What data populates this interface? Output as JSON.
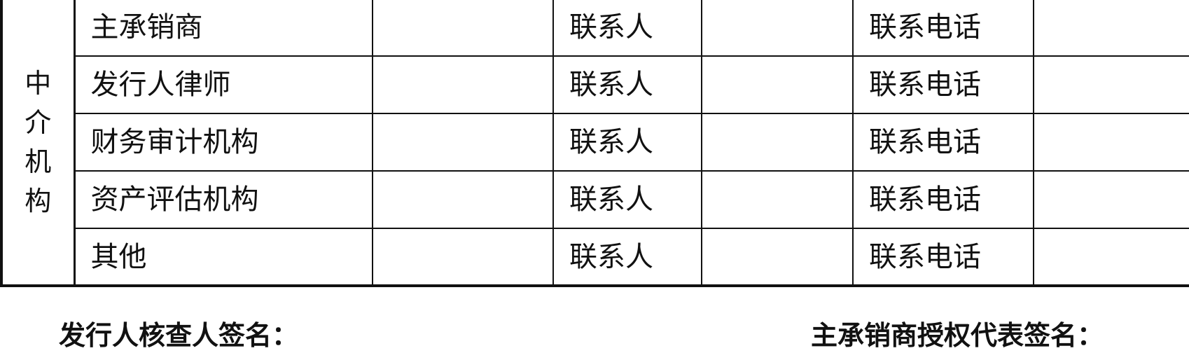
{
  "table": {
    "group_label": "中介机构",
    "rows": [
      {
        "role": "主承销商",
        "contact_label": "联系人",
        "phone_label": "联系电话"
      },
      {
        "role": "发行人律师",
        "contact_label": "联系人",
        "phone_label": "联系电话"
      },
      {
        "role": "财务审计机构",
        "contact_label": "联系人",
        "phone_label": "联系电话"
      },
      {
        "role": "资产评估机构",
        "contact_label": "联系人",
        "phone_label": "联系电话"
      },
      {
        "role": "其他",
        "contact_label": "联系人",
        "phone_label": "联系电话"
      }
    ]
  },
  "signatures": {
    "issuer_verifier": "发行人核查人签名：",
    "underwriter_rep": "主承销商授权代表签名："
  }
}
